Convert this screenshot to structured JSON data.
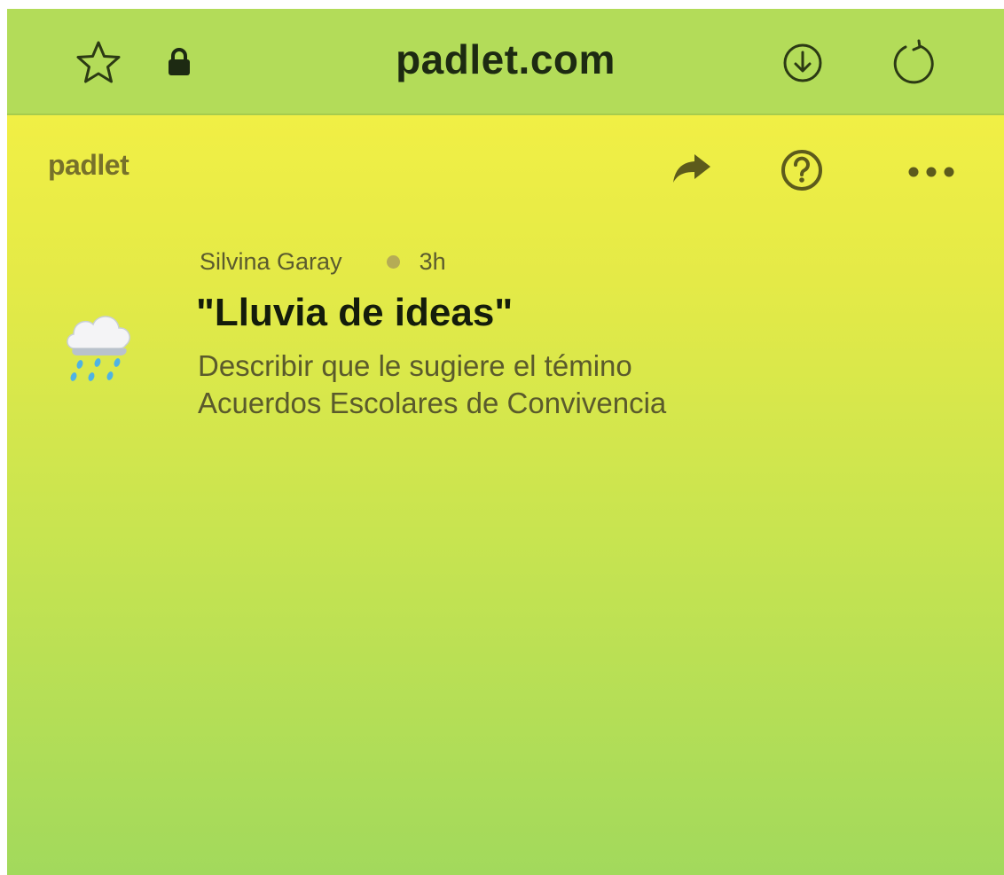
{
  "browser": {
    "url": "padlet.com",
    "icons": [
      "star-outline-icon",
      "lock-icon",
      "download-icon",
      "reload-icon"
    ]
  },
  "header": {
    "brand": "padlet",
    "icons": [
      "share-arrow-icon",
      "help-circle-icon",
      "more-dots-icon"
    ]
  },
  "post": {
    "author": "Silvina Garay",
    "time": "3h",
    "title": "\"Lluvia de ideas\"",
    "description_lines": [
      "Describir que le sugiere el témino",
      "Acuerdos Escolares de Convivencia"
    ],
    "emoji": "cloud-with-rain-icon"
  },
  "colors": {
    "urlbar_bg": "#b3dc59",
    "gradient_top": "#f1ef45",
    "gradient_bottom": "#a2d95c",
    "brand_text": "#77712b",
    "icon_olive": "#6b6a25"
  }
}
